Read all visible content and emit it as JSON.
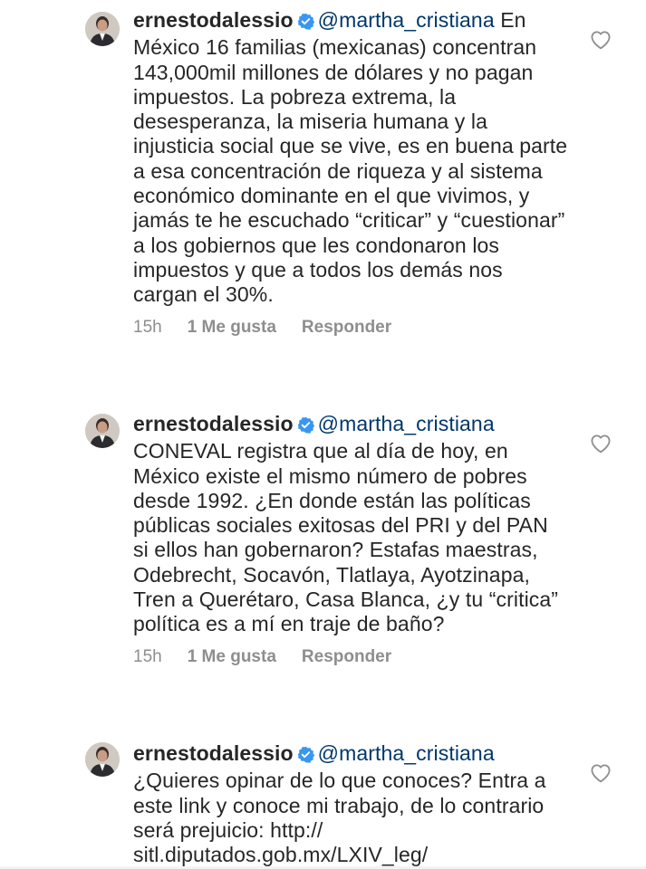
{
  "comments": [
    {
      "username": "ernestodalessio",
      "mention": "@martha_cristiana",
      "text": "En México 16 familias (mexicanas) concentran 143,000mil millones de dólares y no pagan impuestos. La pobreza extrema, la desesperanza, la miseria humana y la injusticia social que se vive, es en buena parte a esa concentración de riqueza y al sistema económico dominante en el que vivimos, y jamás te he escuchado “criticar” y “cuestionar” a los gobiernos que les condonaron los impuestos y que a todos los demás nos cargan el 30%.",
      "time": "15h",
      "likes": "1 Me gusta",
      "reply": "Responder"
    },
    {
      "username": "ernestodalessio",
      "mention": "@martha_cristiana",
      "text": "CONEVAL registra que al día de hoy, en México existe el mismo número de pobres desde 1992. ¿En donde están las políticas públicas sociales exitosas del PRI y del PAN si ellos han gobernaron? Estafas maestras, Odebrecht, Socavón, Tlatlaya, Ayotzinapa, Tren a Querétaro, Casa Blanca, ¿y tu “critica” política es a mí en traje de baño?",
      "time": "15h",
      "likes": "1 Me gusta",
      "reply": "Responder"
    },
    {
      "username": "ernestodalessio",
      "mention": "@martha_cristiana",
      "text": "¿Quieres opinar de lo que conoces? Entra a este link y conoce mi trabajo, de lo contrario será prejuicio: http:// sitl.diputados.gob.mx/LXIV_leg/"
    }
  ],
  "colors": {
    "text": "#262626",
    "mention": "#00376b",
    "meta": "#8e8e8e",
    "verified": "#3897f0"
  },
  "icons": {
    "like": "heart-outline-icon",
    "verified": "verified-badge-icon"
  }
}
